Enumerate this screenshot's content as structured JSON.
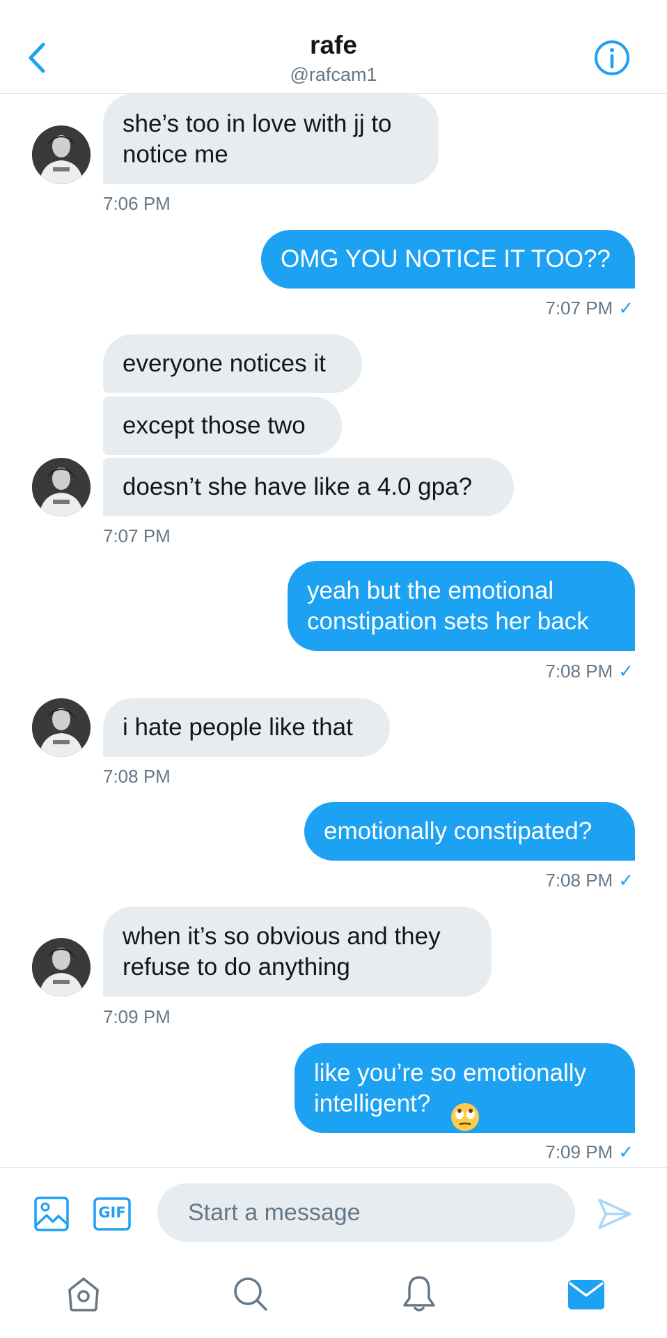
{
  "header": {
    "title": "rafe",
    "handle": "@rafcam1",
    "icons": {
      "back": "chevron-left-icon",
      "info": "info-circle-icon"
    }
  },
  "messages": [
    {
      "from": "them",
      "text": "she’s too in love with jj to\nnotice me",
      "time": "7:06 PM"
    },
    {
      "from": "me",
      "text": "OMG YOU NOTICE IT TOO??",
      "time": "7:07 PM"
    },
    {
      "from": "them",
      "text": "everyone notices it"
    },
    {
      "from": "them",
      "text": "except those two"
    },
    {
      "from": "them",
      "text": "doesn’t she have like a 4.0 gpa?",
      "time": "7:07 PM"
    },
    {
      "from": "me",
      "text": "yeah but the emotional\nconstipation sets her back",
      "time": "7:08 PM"
    },
    {
      "from": "them",
      "text": "i hate people like that",
      "time": "7:08 PM"
    },
    {
      "from": "me",
      "text": "emotionally constipated?",
      "time": "7:08 PM"
    },
    {
      "from": "them",
      "text": "when it’s so obvious and they\nrefuse to do anything",
      "time": "7:09 PM"
    },
    {
      "from": "me",
      "text": "like you’re so emotionally\nintelligent?",
      "emoji": "face-with-rolling-eyes",
      "time": "7:09 PM"
    }
  ],
  "read_check": "✓",
  "composer": {
    "placeholder": "Start a message",
    "value": "",
    "gif_label": "GIF",
    "icons": {
      "media": "image-icon",
      "gif": "gif-icon",
      "send": "send-icon"
    }
  },
  "tabbar": {
    "items": [
      {
        "name": "home",
        "icon": "home-icon",
        "active": false
      },
      {
        "name": "search",
        "icon": "search-icon",
        "active": false
      },
      {
        "name": "notifications",
        "icon": "bell-icon",
        "active": false
      },
      {
        "name": "messages",
        "icon": "mail-icon",
        "active": true
      }
    ]
  },
  "colors": {
    "accent": "#1da1f2",
    "incoming_bubble": "#e6ecf0",
    "secondary_text": "#657786",
    "inactive_icon": "#657786"
  }
}
